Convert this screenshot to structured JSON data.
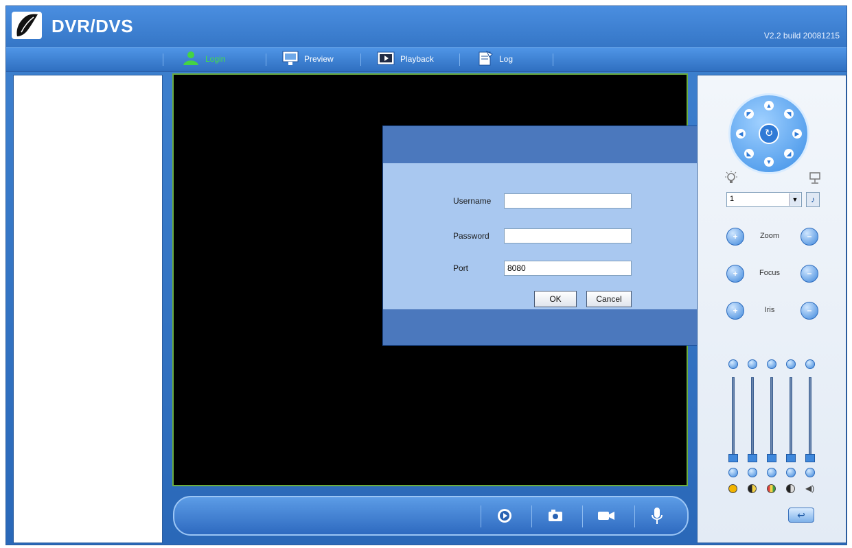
{
  "header": {
    "title": "DVR/DVS",
    "version": "V2.2 build 20081215"
  },
  "nav": {
    "items": [
      {
        "label": "Login",
        "icon": "user-icon",
        "active": true
      },
      {
        "label": "Preview",
        "icon": "monitor-icon",
        "active": false
      },
      {
        "label": "Playback",
        "icon": "playback-icon",
        "active": false
      },
      {
        "label": "Log",
        "icon": "log-icon",
        "active": false
      }
    ]
  },
  "login_dialog": {
    "username_label": "Username",
    "username_value": "",
    "password_label": "Password",
    "password_value": "",
    "port_label": "Port",
    "port_value": "8080",
    "ok_label": "OK",
    "cancel_label": "Cancel"
  },
  "toolbar": {
    "buttons": [
      "play-icon",
      "snapshot-icon",
      "record-icon",
      "microphone-icon"
    ]
  },
  "ptz": {
    "preset_value": "1",
    "zoom_label": "Zoom",
    "focus_label": "Focus",
    "iris_label": "Iris"
  },
  "colors": {
    "header_blue": "#3576c6",
    "active_nav": "#44e044",
    "video_border": "#6cae3e",
    "dialog_bg": "#a9c8f0",
    "dialog_bar": "#4b78bd"
  }
}
